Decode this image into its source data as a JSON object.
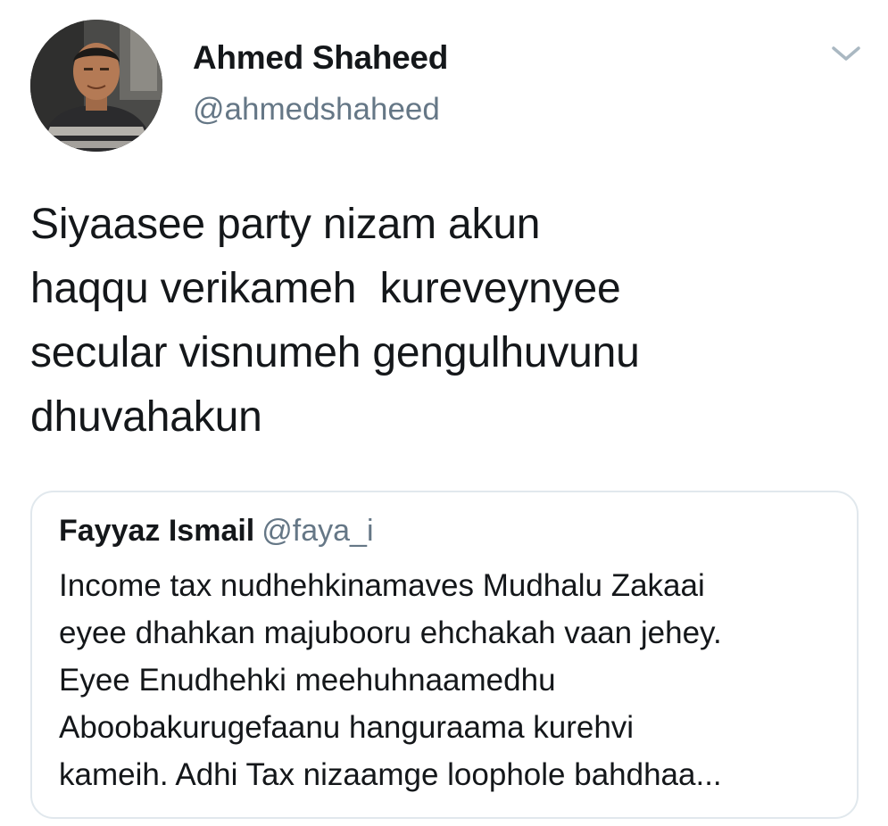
{
  "tweet": {
    "author": {
      "name": "Ahmed Shaheed",
      "handle": "@ahmedshaheed",
      "avatar_icon": "user-photo"
    },
    "menu_icon": "chevron-down-icon",
    "text": "Siyaasee party nizam akun\nhaqqu verikameh  kureveynyee\nsecular visnumeh gengulhuvunu\ndhuvahakun"
  },
  "quoted_tweet": {
    "author": {
      "name": "Fayyaz Ismail",
      "handle": "@faya_i"
    },
    "text": "Income tax nudhehkinamaves Mudhalu Zakaai\neyee dhahkan majubooru ehchakah vaan jehey.\nEyee Enudhehki meehuhnaamedhu\nAboobakurugefaanu hanguraama kurehvi\nkameih. Adhi Tax nizaamge loophole bahdhaa..."
  },
  "colors": {
    "text_primary": "#14171a",
    "text_secondary": "#657786",
    "border": "#e1e8ed",
    "background": "#ffffff"
  }
}
